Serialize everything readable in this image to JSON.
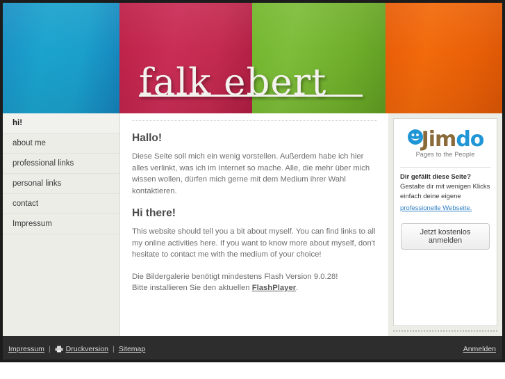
{
  "header": {
    "logo_text": "falk ebert",
    "bands": [
      {
        "name": "blue",
        "color": "#1a9fcb"
      },
      {
        "name": "pink",
        "color": "#c32a4f"
      },
      {
        "name": "green",
        "color": "#73b62c"
      },
      {
        "name": "orange",
        "color": "#ea6007"
      }
    ]
  },
  "sidebar": {
    "items": [
      {
        "label": "hi!",
        "active": true
      },
      {
        "label": "about me",
        "active": false
      },
      {
        "label": "professional links",
        "active": false
      },
      {
        "label": "personal links",
        "active": false
      },
      {
        "label": "contact",
        "active": false
      },
      {
        "label": "Impressum",
        "active": false
      }
    ]
  },
  "main": {
    "heading_de": "Hallo!",
    "paragraph_de": "Diese Seite soll mich ein wenig vorstellen. Außerdem habe ich hier alles verlinkt, was ich im Internet so mache. Alle, die mehr über mich wissen wollen, dürfen mich gerne mit dem Medium ihrer Wahl kontaktieren.",
    "heading_en": "Hi there!",
    "paragraph_en": "This website should tell you a bit about myself. You can find links to all my online activities here. If you want to know more about myself, don't hesitate to contact me with the medium of your choice!",
    "flash_line1": "Die Bildergalerie benötigt mindestens Flash Version 9.0.28!",
    "flash_line2_prefix": "Bitte installieren Sie den aktuellen ",
    "flash_link": "FlashPlayer",
    "flash_line2_suffix": "."
  },
  "promo": {
    "logo_part1": "Jim",
    "logo_part2": "do",
    "tagline": "Pages to the People",
    "headline": "Dir gefällt diese Seite?",
    "text_line1": "Gestalte dir mit wenigen Klicks",
    "text_line2": "einfach deine eigene",
    "link": "professionelle Webseite.",
    "button": "Jetzt kostenlos anmelden",
    "link_color": "#2f7fc4",
    "smiley_color": "#2196d6"
  },
  "footer": {
    "impressum": "Impressum",
    "separator": "|",
    "druckversion": "Druckversion",
    "sitemap": "Sitemap",
    "anmelden": "Anmelden"
  }
}
